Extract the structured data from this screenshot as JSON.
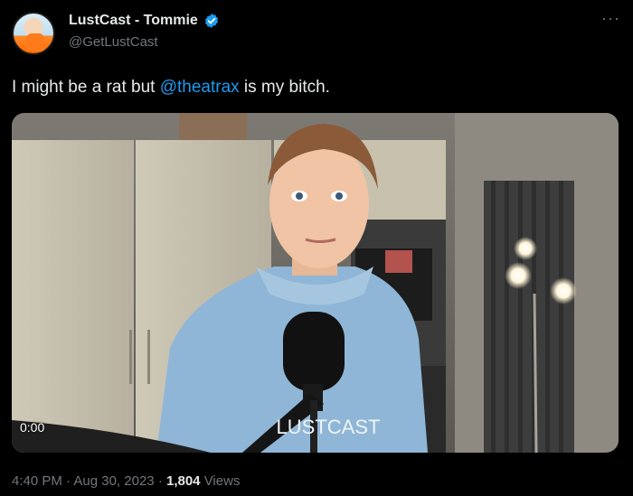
{
  "author": {
    "display_name": "LustCast - Tommie",
    "handle": "@GetLustCast",
    "verified": true
  },
  "tweet": {
    "text_before": "I might be a rat but ",
    "mention": "@theatrax",
    "text_after": " is my bitch."
  },
  "video": {
    "current_time": "0:00",
    "shirt_text": "LUSTCAST"
  },
  "meta": {
    "time": "4:40 PM",
    "date": "Aug 30, 2023",
    "views_count": "1,804",
    "views_label": "Views",
    "separator": "·"
  },
  "icons": {
    "more": "more-icon",
    "verified": "verified-badge-icon"
  },
  "colors": {
    "background": "#000000",
    "text_primary": "#e7e9ea",
    "text_secondary": "#71767b",
    "accent": "#1d9bf0"
  }
}
